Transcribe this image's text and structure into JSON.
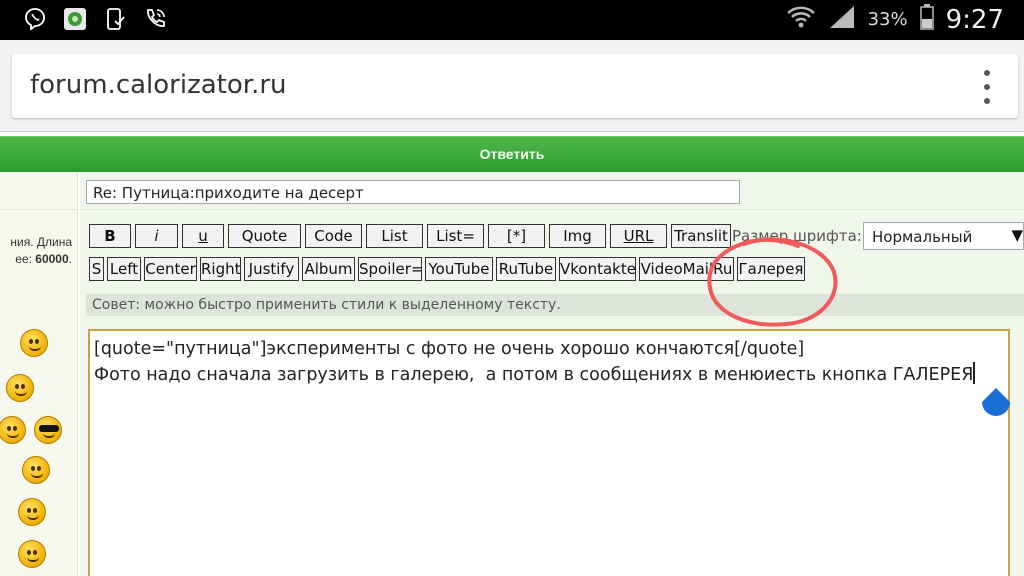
{
  "status_bar": {
    "battery_percent": "33%",
    "time": "9:27"
  },
  "browser": {
    "url": "forum.calorizator.ru"
  },
  "reply_bar": {
    "title": "Ответить"
  },
  "left_column": {
    "text_line1": "ния. Длина",
    "text_line2_prefix": "ее: ",
    "text_line2_value": "60000",
    "text_line2_suffix": "."
  },
  "form": {
    "subject_value": "Re: Путница:приходите на десерт",
    "toolbar_row1": [
      {
        "label": "B",
        "style": "bold"
      },
      {
        "label": "i",
        "style": "italic"
      },
      {
        "label": "u",
        "style": "underline"
      },
      {
        "label": "Quote",
        "style": ""
      },
      {
        "label": "Code",
        "style": ""
      },
      {
        "label": "List",
        "style": ""
      },
      {
        "label": "List=",
        "style": ""
      },
      {
        "label": "[*]",
        "style": ""
      },
      {
        "label": "Img",
        "style": ""
      },
      {
        "label": "URL",
        "style": "underline"
      },
      {
        "label": "Translit",
        "style": ""
      }
    ],
    "toolbar_row2": [
      {
        "label": "S"
      },
      {
        "label": "Left"
      },
      {
        "label": "Center"
      },
      {
        "label": "Right"
      },
      {
        "label": "Justify"
      },
      {
        "label": "Album"
      },
      {
        "label": "Spoiler="
      },
      {
        "label": "YouTube"
      },
      {
        "label": "RuTube"
      },
      {
        "label": "Vkontakte"
      },
      {
        "label": "VideoMailRu"
      },
      {
        "label": "Галерея"
      }
    ],
    "font_size_label": "Размер шрифта:",
    "font_size_value": "Нормальный",
    "tip": "Совет: можно быстро применить стили к выделенному тексту.",
    "message_line1": "[quote=\"путница\"]эксперименты с фото не очень хорошо кончаются[/quote]",
    "message_line2": "Фото надо сначала загрузить в галерею,  а потом в сообщениях в менюиесть кнопка ГАЛЕРЕЯ"
  },
  "colors": {
    "reply_bar": "#34a234",
    "annotation": "#f05a5a",
    "text_handle": "#1a6fd6"
  }
}
